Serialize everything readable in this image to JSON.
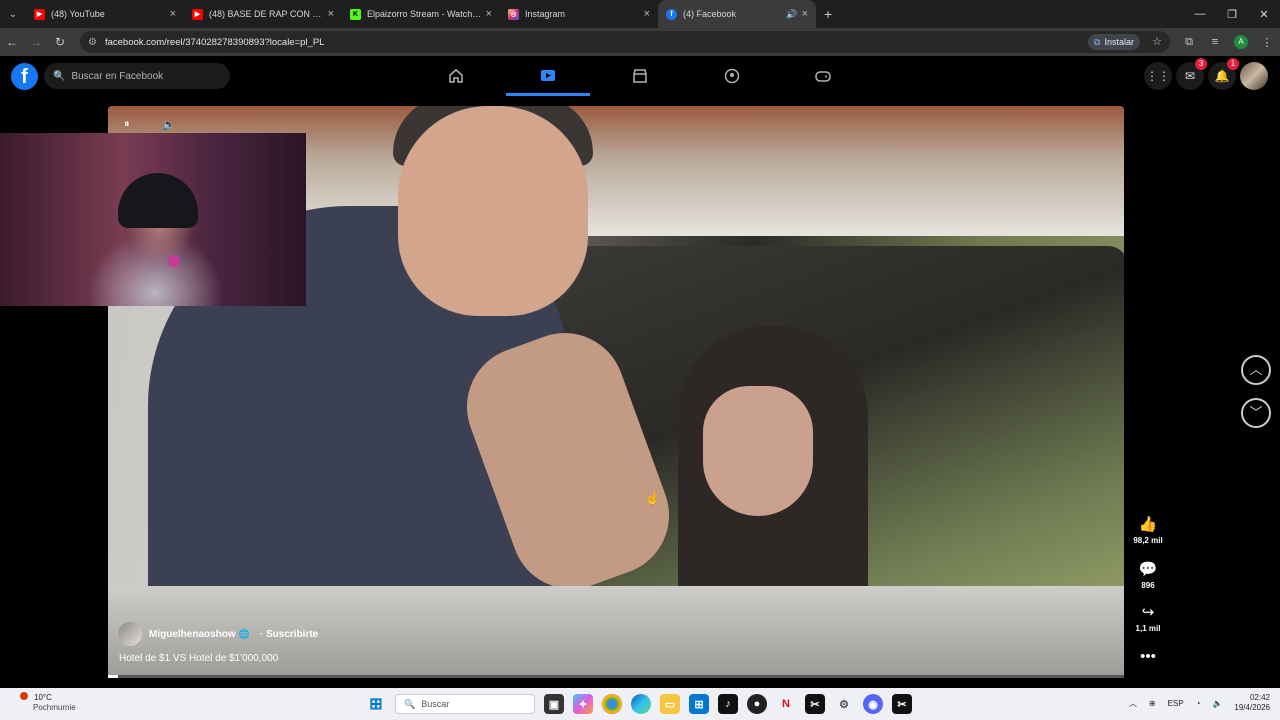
{
  "browser": {
    "tabs": [
      {
        "title": "(48) YouTube",
        "color": "#ff0000",
        "glyph": "▶"
      },
      {
        "title": "(48) BASE DE RAP CON PALABRAS",
        "color": "#ff0000",
        "glyph": "▶"
      },
      {
        "title": "Elpaizorro Stream - Watch Live",
        "color": "#53fc18",
        "glyph": "K"
      },
      {
        "title": "Instagram",
        "color": "#d62976",
        "glyph": "◎"
      },
      {
        "title": "(4) Facebook",
        "color": "#1877f2",
        "glyph": "f"
      }
    ],
    "url": "facebook.com/reel/374028278390893?locale=pl_PL",
    "install_label": "Instalar",
    "profile_letter": "A"
  },
  "facebook": {
    "logo": "f",
    "search_placeholder": "Buscar en Facebook",
    "messenger_badge": "3",
    "notifications_badge": "1"
  },
  "reel": {
    "author": "Miguelhenaoshow",
    "subscribe": "· Suscribirte",
    "caption": "Hotel de $1 VS Hotel de $1'000,000",
    "progress_fraction": 0.01,
    "likes": "98,2 mil",
    "comments": "896",
    "shares": "1,1 mil"
  },
  "taskbar": {
    "temperature": "10°C",
    "location": "Pochmurnie",
    "search_label": "Buscar",
    "language": "ESP",
    "time": "02:42",
    "date": "19/4/2026"
  }
}
